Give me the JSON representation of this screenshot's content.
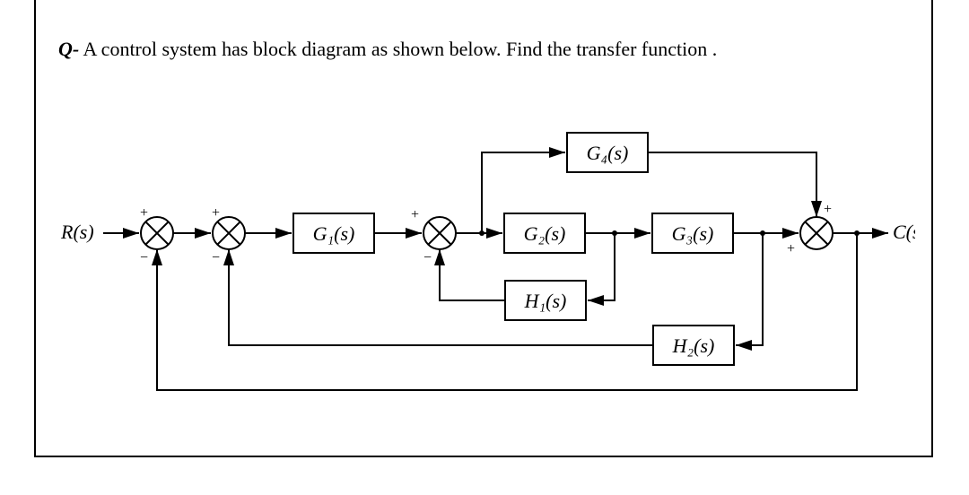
{
  "question": {
    "prefix": "Q-",
    "text": " A control system has block diagram as shown below. Find the transfer function ."
  },
  "diagram": {
    "input_label": "R(s)",
    "output_label": "C(s)",
    "blocks": {
      "G1": "G₁(s)",
      "G2": "G₂(s)",
      "G3": "G₃(s)",
      "G4": "G₄(s)",
      "H1": "H₁(s)",
      "H2": "H₂(s)"
    },
    "summing_junctions": [
      {
        "id": "S1",
        "inputs": [
          "+",
          "-"
        ]
      },
      {
        "id": "S2",
        "inputs": [
          "+",
          "-"
        ]
      },
      {
        "id": "S3",
        "inputs": [
          "+",
          "-"
        ]
      },
      {
        "id": "S4",
        "inputs": [
          "+",
          "+"
        ]
      }
    ],
    "signal_flow": [
      "R(s) -> S1(+) -> S2(+) -> G1 -> S3(+) -> G2 -> node_a -> G3 -> node_b -> S4(+) -> C(s)",
      "node_a -> G4 -> S4(+)   (feedforward)",
      "node_a -> H1 -> S3(-)   (inner feedback)",
      "node_b -> H2 -> S2(-)   (middle feedback)",
      "C(s) -> S1(-)           (outer unity feedback)"
    ]
  }
}
